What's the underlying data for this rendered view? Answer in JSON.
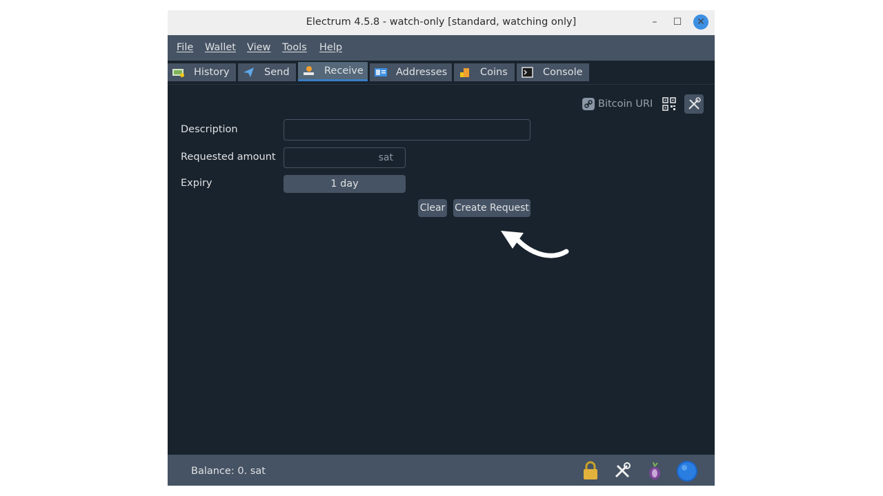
{
  "window": {
    "title": "Electrum 4.5.8  -  watch-only  [standard, watching only]",
    "minimize_glyph": "–",
    "maximize_glyph": "☐",
    "close_glyph": "✕"
  },
  "menu": {
    "items": [
      {
        "label": "File"
      },
      {
        "label": "Wallet"
      },
      {
        "label": "View"
      },
      {
        "label": "Tools"
      },
      {
        "label": "Help"
      }
    ]
  },
  "tabs": [
    {
      "label": "History",
      "icon": "history-icon"
    },
    {
      "label": "Send",
      "icon": "send-icon"
    },
    {
      "label": "Receive",
      "icon": "receive-icon",
      "active": true
    },
    {
      "label": "Addresses",
      "icon": "addresses-icon"
    },
    {
      "label": "Coins",
      "icon": "coins-icon"
    },
    {
      "label": "Console",
      "icon": "console-icon"
    }
  ],
  "receive": {
    "toolbar": {
      "bitcoin_uri_label": "Bitcoin URI",
      "icons": [
        "link-icon",
        "qr-code-icon",
        "tools-icon"
      ]
    },
    "description_label": "Description",
    "description_value": "",
    "amount_label": "Requested amount",
    "amount_value": "",
    "amount_unit": "sat",
    "expiry_label": "Expiry",
    "expiry_value": "1 day",
    "clear_label": "Clear",
    "create_label": "Create Request"
  },
  "status": {
    "balance": "Balance: 0. sat",
    "icons": [
      "lock-icon",
      "preferences-icon",
      "tor-icon",
      "network-status-icon"
    ]
  },
  "colors": {
    "window_bg": "#19232d",
    "bar_bg": "#455364",
    "text": "#e0e1e3",
    "accent": "#3a7fc4"
  }
}
